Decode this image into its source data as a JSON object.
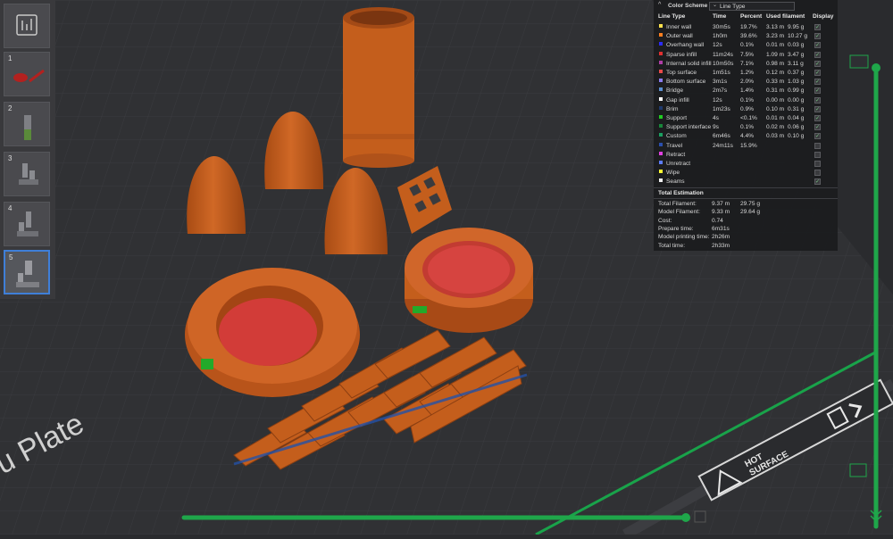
{
  "viewport": {
    "plate_label": "u Plate",
    "hot_surface_line1": "HOT",
    "hot_surface_line2": "SURFACE"
  },
  "thumbnails": [
    {
      "number": "1"
    },
    {
      "number": "2"
    },
    {
      "number": "3"
    },
    {
      "number": "4"
    },
    {
      "number": "5",
      "active": true
    }
  ],
  "legend": {
    "header_title": "Color Scheme",
    "selected_scheme": "Line Type",
    "columns": {
      "line_type": "Line Type",
      "time": "Time",
      "percent": "Percent",
      "used_filament": "Used filament",
      "display": "Display"
    },
    "rows": [
      {
        "name": "Inner wall",
        "time": "30m5s",
        "percent": "19.7%",
        "length": "3.13 m",
        "weight": "9.95 g",
        "color": "#ffe14d",
        "checked": true
      },
      {
        "name": "Outer wall",
        "time": "1h0m",
        "percent": "39.6%",
        "length": "3.23 m",
        "weight": "10.27 g",
        "color": "#ff7f1f",
        "checked": true
      },
      {
        "name": "Overhang wall",
        "time": "12s",
        "percent": "0.1%",
        "length": "0.01 m",
        "weight": "0.03 g",
        "color": "#2c2cff",
        "checked": true
      },
      {
        "name": "Sparse infill",
        "time": "11m24s",
        "percent": "7.5%",
        "length": "1.09 m",
        "weight": "3.47 g",
        "color": "#e03030",
        "checked": true
      },
      {
        "name": "Internal solid infill",
        "time": "10m50s",
        "percent": "7.1%",
        "length": "0.98 m",
        "weight": "3.11 g",
        "color": "#b03da6",
        "checked": true
      },
      {
        "name": "Top surface",
        "time": "1m51s",
        "percent": "1.2%",
        "length": "0.12 m",
        "weight": "0.37 g",
        "color": "#e84a4a",
        "checked": true
      },
      {
        "name": "Bottom surface",
        "time": "3m1s",
        "percent": "2.0%",
        "length": "0.33 m",
        "weight": "1.03 g",
        "color": "#8a7cf0",
        "checked": true
      },
      {
        "name": "Bridge",
        "time": "2m7s",
        "percent": "1.4%",
        "length": "0.31 m",
        "weight": "0.99 g",
        "color": "#5a8fd0",
        "checked": true
      },
      {
        "name": "Gap infill",
        "time": "12s",
        "percent": "0.1%",
        "length": "0.00 m",
        "weight": "0.00 g",
        "color": "#ffffff",
        "checked": true
      },
      {
        "name": "Brim",
        "time": "1m23s",
        "percent": "0.9%",
        "length": "0.10 m",
        "weight": "0.31 g",
        "color": "#1f3a6e",
        "checked": true
      },
      {
        "name": "Support",
        "time": "4s",
        "percent": "<0.1%",
        "length": "0.01 m",
        "weight": "0.04 g",
        "color": "#22cc22",
        "checked": true
      },
      {
        "name": "Support interface",
        "time": "9s",
        "percent": "0.1%",
        "length": "0.02 m",
        "weight": "0.06 g",
        "color": "#18873a",
        "checked": true
      },
      {
        "name": "Custom",
        "time": "6m46s",
        "percent": "4.4%",
        "length": "0.03 m",
        "weight": "0.10 g",
        "color": "#1aa060",
        "checked": true
      },
      {
        "name": "Travel",
        "time": "24m11s",
        "percent": "15.9%",
        "length": "",
        "weight": "",
        "color": "#2a4fae",
        "checked": false
      },
      {
        "name": "Retract",
        "time": "",
        "percent": "",
        "length": "",
        "weight": "",
        "color": "#e040e0",
        "checked": false
      },
      {
        "name": "Unretract",
        "time": "",
        "percent": "",
        "length": "",
        "weight": "",
        "color": "#5c7cff",
        "checked": false
      },
      {
        "name": "Wipe",
        "time": "",
        "percent": "",
        "length": "",
        "weight": "",
        "color": "#ffff33",
        "checked": false
      },
      {
        "name": "Seams",
        "time": "",
        "percent": "",
        "length": "",
        "weight": "",
        "color": "#f0f0f0",
        "checked": true
      }
    ],
    "estimation_title": "Total Estimation",
    "estimation": [
      {
        "label": "Total Filament:",
        "value1": "9.37 m",
        "value2": "29.75 g"
      },
      {
        "label": "Model Filament:",
        "value1": "9.33 m",
        "value2": "29.64 g"
      },
      {
        "label": "Cost:",
        "value1": "0.74",
        "value2": ""
      },
      {
        "label": "Prepare time:",
        "value1": "6m31s",
        "value2": ""
      },
      {
        "label": "Model printing time:",
        "value1": "2h26m",
        "value2": ""
      },
      {
        "label": "Total time:",
        "value1": "2h33m",
        "value2": ""
      }
    ]
  },
  "colors": {
    "accent_green": "#1fa64a",
    "model_orange": "#c85f1e",
    "infill_red": "#d63a38",
    "selection_blue": "#3f7fd8"
  }
}
